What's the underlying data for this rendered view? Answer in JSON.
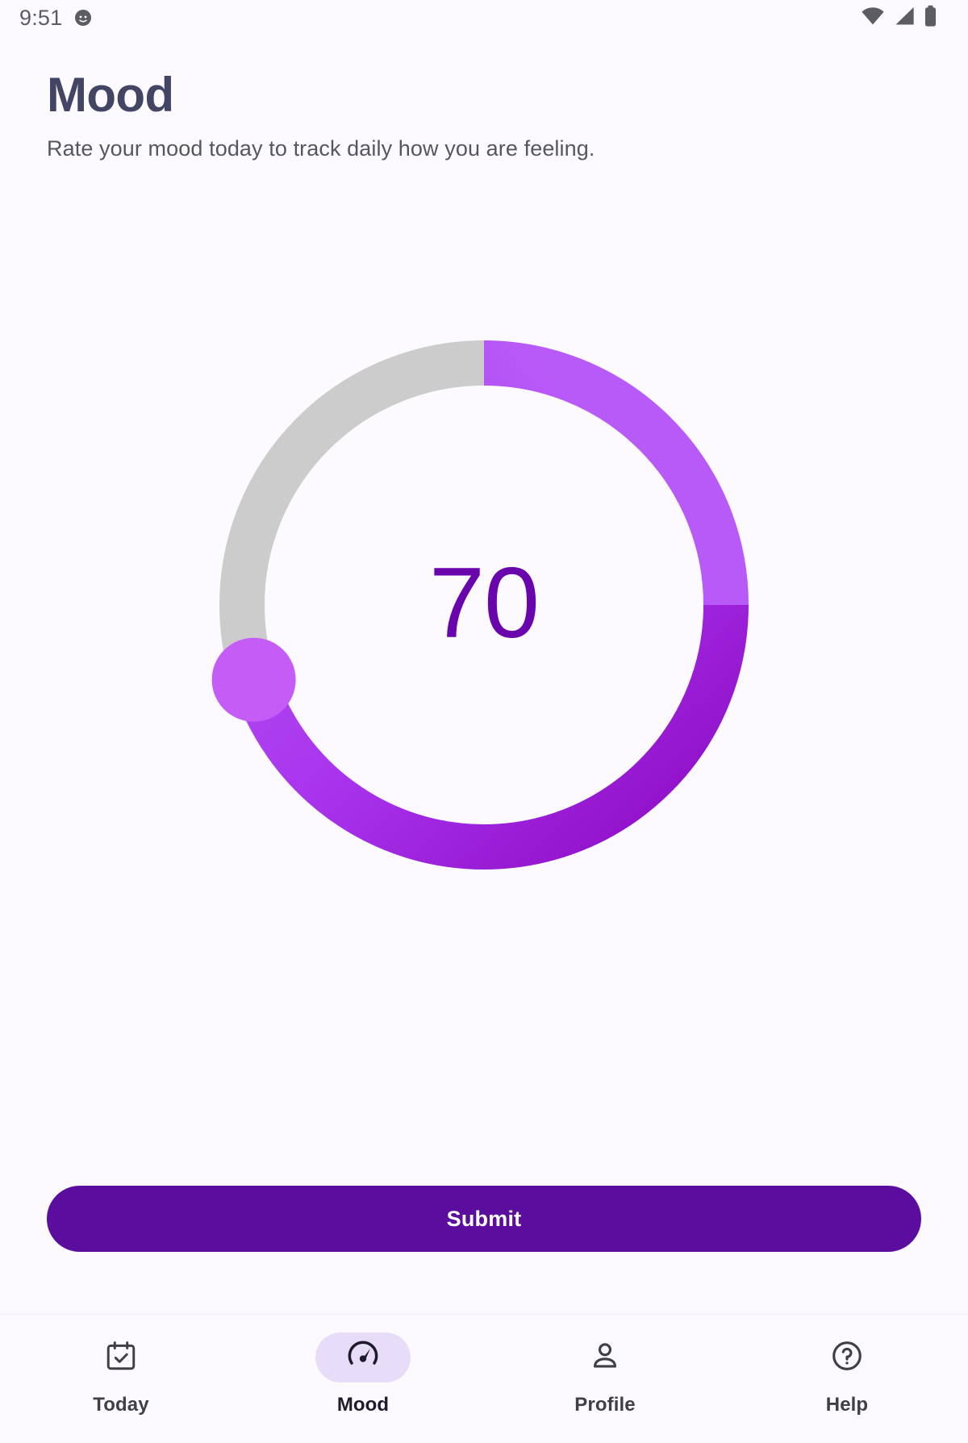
{
  "status_bar": {
    "time": "9:51",
    "notification_icon": "face-notification-icon",
    "wifi_icon": "wifi-icon",
    "signal_icon": "cellular-signal-icon",
    "battery_icon": "battery-full-icon",
    "icon_color": "#5C5C63"
  },
  "header": {
    "title": "Mood",
    "subtitle": "Rate your mood today to track daily how you are feeling.",
    "title_color": "#434564",
    "subtitle_color": "#55575F"
  },
  "gauge": {
    "name": "mood-circular-slider",
    "value": "70",
    "value_number": 70,
    "min": 0,
    "max": 100,
    "percent": 70,
    "value_color": "#6A05AD",
    "track_color": "#CCCCCC",
    "thumb_color": "#C45CF5",
    "progress_gradient_start": "#A22BE8",
    "progress_gradient_mid": "#B54DF6",
    "progress_gradient_end": "#9010C8",
    "start_angle_deg": 0,
    "sweep_deg": 252
  },
  "submit": {
    "label": "Submit",
    "background": "#5B0E9E",
    "text_color": "#FFFFFF"
  },
  "bottom_nav": {
    "active_index": 1,
    "active_pill_color": "#E7DDF8",
    "items": [
      {
        "label": "Today",
        "icon": "calendar-check-icon",
        "active": false
      },
      {
        "label": "Mood",
        "icon": "speedometer-icon",
        "active": true
      },
      {
        "label": "Profile",
        "icon": "person-icon",
        "active": false
      },
      {
        "label": "Help",
        "icon": "help-circle-icon",
        "active": false
      }
    ]
  },
  "page": {
    "background": "#FDFAFF"
  }
}
